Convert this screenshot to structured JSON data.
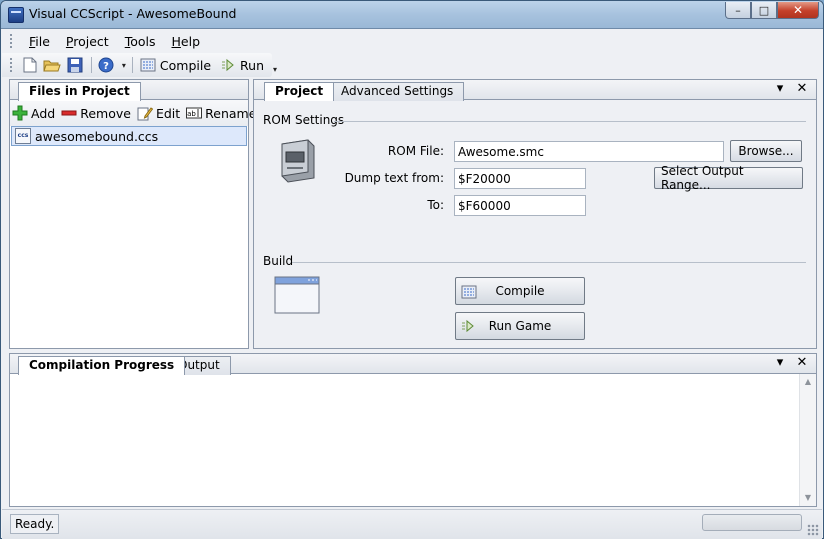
{
  "window": {
    "title": "Visual CCScript - AwesomeBound",
    "minimize_glyph": "–",
    "maximize_glyph": "□",
    "close_glyph": "✕"
  },
  "menu": {
    "items": [
      {
        "label_u": "F",
        "label_rest": "ile"
      },
      {
        "label_u": "P",
        "label_rest": "roject"
      },
      {
        "label_u": "T",
        "label_rest": "ools"
      },
      {
        "label_u": "H",
        "label_rest": "elp"
      }
    ]
  },
  "toolbar": {
    "icons": [
      "new-file-icon",
      "open-folder-icon",
      "save-icon",
      "help-icon"
    ],
    "compile_label": "Compile",
    "run_label": "Run"
  },
  "files_panel": {
    "tab_label": "Files in Project",
    "add_label": "Add",
    "remove_label": "Remove",
    "edit_label": "Edit",
    "rename_label": "Rename",
    "files": [
      "awesomebound.ccs"
    ]
  },
  "project_panel": {
    "tabs": [
      "Project",
      "Advanced Settings"
    ],
    "rom_settings_label": "ROM Settings",
    "rom_file_label": "ROM File:",
    "rom_file_value": "Awesome.smc",
    "browse_label": "Browse...",
    "dump_from_label": "Dump text from:",
    "dump_from_value": "$F20000",
    "to_label": "To:",
    "to_value": "$F60000",
    "select_range_label": "Select Output Range...",
    "build_label": "Build",
    "compile_button": "Compile",
    "run_game_button": "Run Game"
  },
  "output_panel": {
    "tabs": [
      "Compilation Progress",
      "Output"
    ]
  },
  "panel_controls": {
    "menu_glyph": "▾",
    "close_glyph": "✕"
  },
  "statusbar": {
    "status_text": "Ready.",
    "progress_percent": 0
  }
}
